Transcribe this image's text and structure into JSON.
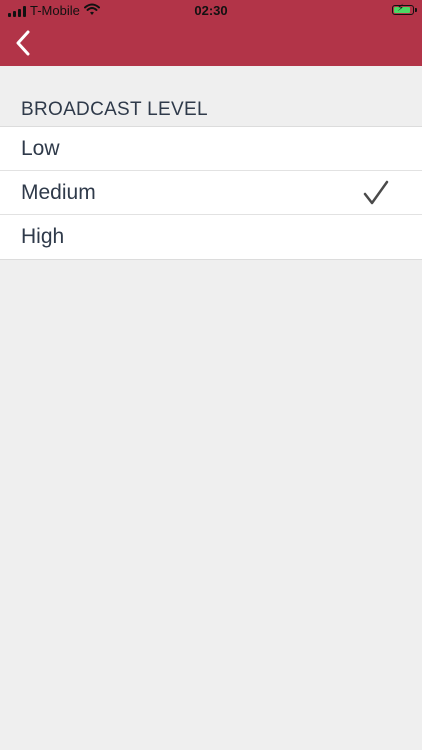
{
  "status_bar": {
    "carrier": "T-Mobile",
    "time": "02:30",
    "icons": [
      "signal-icon",
      "wifi-icon",
      "battery-charging-icon"
    ]
  },
  "header": {
    "back_icon": "chevron-left-icon",
    "color": "#b23448"
  },
  "section": {
    "title": "BROADCAST LEVEL"
  },
  "options": [
    {
      "label": "Low",
      "selected": false
    },
    {
      "label": "Medium",
      "selected": true
    },
    {
      "label": "High",
      "selected": false
    }
  ],
  "selected_icon": "checkmark-icon"
}
